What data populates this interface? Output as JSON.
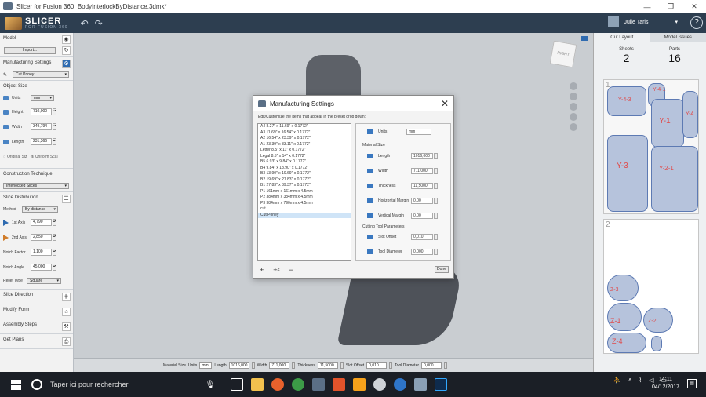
{
  "window": {
    "title": "Slicer for Fusion 360: BodyInterlockByDistance.3dmk*"
  },
  "appbar": {
    "logo_main": "SLICER",
    "logo_sub": "FOR FUSION 360",
    "user_name": "Julie Taris",
    "help": "?"
  },
  "left": {
    "model_label": "Model",
    "import_label": "Import...",
    "manufacturing_label": "Manufacturing Settings",
    "preset_value": "Cut Poney",
    "object_size_label": "Object Size",
    "units_label": "Units",
    "units_value": "mm",
    "height_label": "Height",
    "height_value": "710,000",
    "width_label": "Width",
    "width_value": "349,794",
    "length_label": "Length",
    "length_value": "231,366",
    "original_size_label": "Original Siz",
    "uniform_scale_label": "Uniform Scal",
    "construction_label": "Construction Technique",
    "construction_value": "Interlocked Slices",
    "slice_dist_label": "Slice Distribution",
    "method_label": "Method",
    "method_value": "By distance",
    "axis1_label": "1st Axis",
    "axis1_value": "4,790",
    "axis2_label": "2nd Axis",
    "axis2_value": "2,850",
    "notch_factor_label": "Notch Factor",
    "notch_factor_value": "1,100",
    "notch_angle_label": "Notch Angle",
    "notch_angle_value": "45,000",
    "relief_type_label": "Relief Type",
    "relief_type_value": "Square",
    "slice_direction_label": "Slice Direction",
    "modify_form_label": "Modify Form",
    "assembly_steps_label": "Assembly Steps",
    "get_plans_label": "Get Plans"
  },
  "viewport": {
    "viewcube_label": "RIGHT"
  },
  "bottombar": {
    "material_size_label": "Material Size",
    "units_label": "Units",
    "units_value": "mm",
    "length_label": "Length",
    "length_value": "1016,000",
    "width_label": "Width",
    "width_value": "711,000",
    "thickness_label": "Thickness",
    "thickness_value": "11,5000",
    "slot_offset_label": "Slot Offset",
    "slot_offset_value": "0,010",
    "tool_diameter_label": "Tool Diameter",
    "tool_diameter_value": "0,000"
  },
  "right": {
    "tab_cut_layout": "Cut Layout",
    "tab_model_issues": "Model Issues",
    "sheets_label": "Sheets",
    "sheets_value": "2",
    "parts_label": "Parts",
    "parts_value": "16",
    "sheet1_num": "1",
    "sheet2_num": "2",
    "sheet1_labels": [
      "Y-4-1",
      "Y-4-3",
      "Y-1",
      "Y-3",
      "Y-2-1",
      "Y-4"
    ],
    "sheet2_labels": [
      "Z-3",
      "Z-1",
      "Z-2",
      "Z-4"
    ]
  },
  "dialog": {
    "title": "Manufacturing Settings",
    "close": "✕",
    "subtitle": "Edit/Customize the items that appear in the preset drop down:",
    "presets": [
      "A4 8.27\" x 11.69\" x 0.1772\"",
      "A3 11.69\" x 16.54\" x 0.1772\"",
      "A2 16.54\" x 23.39\" x 0.1772\"",
      "A1 23.39\" x 33.11\" x 0.1772\"",
      "Letter 8.5\" x 11\" x 0.1772\"",
      "Legal 8.5\" x 14\" x 0.1772\"",
      "B5 6.93\" x 9.84\" x 0.1772\"",
      "B4 9.84\" x 13.90\" x 0.1772\"",
      "B3 13.90\" x 19.69\" x 0.1772\"",
      "B2 19.69\" x 27.83\" x 0.1772\"",
      "B1 27.83\" x 39.37\" x 0.1772\"",
      "P1 161mm x 161mm x 4.5mm",
      "P2 384mm x 384mm x 4.5mm",
      "P3 384mm x 790mm x 4.5mm",
      "cut",
      "Cut Poney"
    ],
    "units_label": "Units",
    "units_value": "mm",
    "material_size_label": "Material Size",
    "length_label": "Length",
    "length_value": "1016,000",
    "width_label": "Width",
    "width_value": "711,000",
    "thickness_label": "Thickness",
    "thickness_value": "11,5000",
    "h_margin_label": "Horizontal Margin",
    "h_margin_value": "0,00",
    "v_margin_label": "Vertical Margin",
    "v_margin_value": "0,00",
    "cutting_tool_label": "Cutting Tool Parameters",
    "slot_offset_label": "Slot Offset",
    "slot_offset_value": "0,010",
    "tool_diameter_label": "Tool Diameter",
    "tool_diameter_value": "0,000",
    "add_label": "+",
    "duplicate_label": "+²",
    "remove_label": "−",
    "done_label": "Done"
  },
  "taskbar": {
    "search_placeholder": "Taper ici pour rechercher",
    "time": "14:11",
    "date": "04/12/2017"
  }
}
